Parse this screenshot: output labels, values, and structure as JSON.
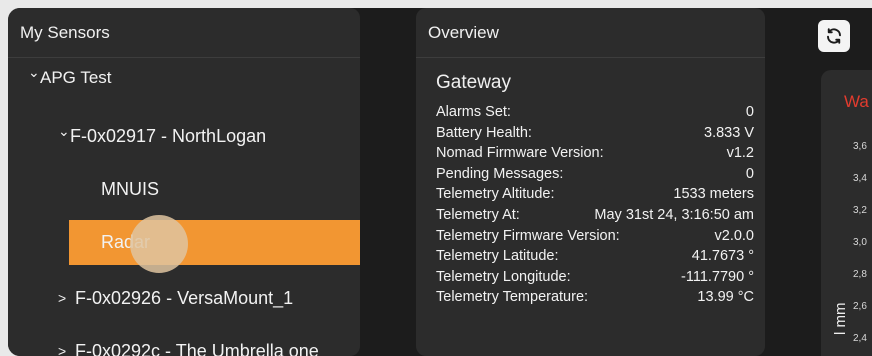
{
  "sensors_panel": {
    "title": "My Sensors",
    "tree": {
      "group": "APG Test",
      "gateway_1": "F-0x02917 - NorthLogan",
      "sensor_mnuis": "MNUIS",
      "sensor_radar": "Radar",
      "gateway_2": "F-0x02926 - VersaMount_1",
      "gateway_3": "F-0x0292c - The Umbrella one"
    },
    "chevrons": {
      "expanded": "⌄",
      "collapsed": ">"
    },
    "selected_color": "#f29632"
  },
  "overview_panel": {
    "title": "Overview",
    "section_title": "Gateway",
    "rows": [
      {
        "label": "Alarms Set:",
        "value": "0"
      },
      {
        "label": "Battery Health:",
        "value": "3.833 V"
      },
      {
        "label": "Nomad Firmware Version:",
        "value": "v1.2"
      },
      {
        "label": "Pending Messages:",
        "value": "0"
      },
      {
        "label": "Telemetry Altitude:",
        "value": "1533 meters"
      },
      {
        "label": "Telemetry At:",
        "value": "May 31st 24, 3:16:50 am"
      },
      {
        "label": "Telemetry Firmware Version:",
        "value": "v2.0.0"
      },
      {
        "label": "Telemetry Latitude:",
        "value": "41.7673 °"
      },
      {
        "label": "Telemetry Longitude:",
        "value": "-111.7790 °"
      },
      {
        "label": "Telemetry Temperature:",
        "value": "13.99 °C"
      }
    ]
  },
  "toolbar": {
    "refresh_icon": "refresh-icon"
  },
  "chart_panel": {
    "title_fragment": "Wa",
    "title_color": "#e23b2e",
    "y_ticks": [
      "3,6",
      "3,4",
      "3,2",
      "3,0",
      "2,8",
      "2,6",
      "2,4"
    ],
    "y_label_fragment": "l mm"
  }
}
